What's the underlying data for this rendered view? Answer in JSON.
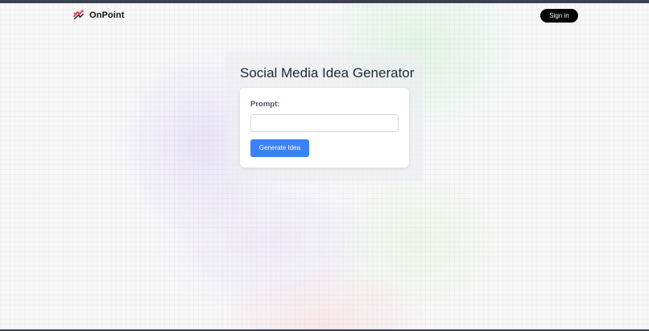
{
  "header": {
    "brand_name": "OnPoint",
    "brand_icon": "onpoint-logo-icon",
    "signin_label": "Sign in"
  },
  "main": {
    "title": "Social Media Idea Generator",
    "prompt_label": "Prompt:",
    "prompt_value": "",
    "prompt_placeholder": "",
    "generate_label": "Generate Idea"
  },
  "colors": {
    "accent_button": "#3b82f6",
    "signin_button": "#000000",
    "top_bar": "#3b4150",
    "logo_red": "#e23b5b"
  }
}
